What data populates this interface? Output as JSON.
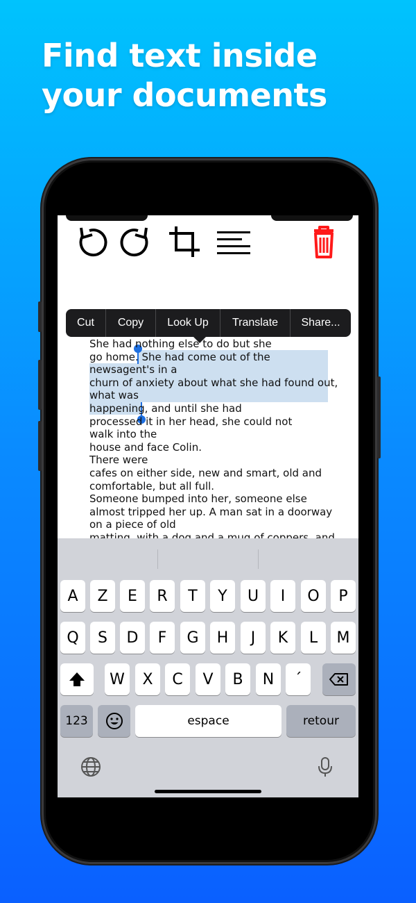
{
  "headline": "Find text inside your documents",
  "toolbar": {
    "icons": [
      "rotate-left-icon",
      "rotate-right-icon",
      "crop-icon",
      "text-align-icon",
      "trash-icon"
    ],
    "trash_color": "#ff1a1a"
  },
  "context_menu": {
    "items": [
      "Cut",
      "Copy",
      "Look Up",
      "Translate",
      "Share..."
    ]
  },
  "document": {
    "lines": [
      "She had nothing else to do but she",
      "go home. She had come out of the",
      "newsagent's in a",
      "churn of anxiety about what she had found out,",
      "what was",
      "happening, and until she had",
      "processed it in her head, she could not",
      "walk into the",
      "house and face Colin.",
      "There were",
      "cafes on either side, new and smart, old and",
      "comfortable, but all full.",
      "Someone bumped into her, someone else",
      "almost tripped her up. A man sat in a doorway",
      "on a piece of old",
      "matting, with a dog and a mug of coppers, and"
    ],
    "selection_color": "#cddff0",
    "handle_color": "#1e6fe0"
  },
  "keyboard": {
    "row1": [
      "A",
      "Z",
      "E",
      "R",
      "T",
      "Y",
      "U",
      "I",
      "O",
      "P"
    ],
    "row2": [
      "Q",
      "S",
      "D",
      "F",
      "G",
      "H",
      "J",
      "K",
      "L",
      "M"
    ],
    "row3": [
      "W",
      "X",
      "C",
      "V",
      "B",
      "N",
      "´"
    ],
    "numbers_key": "123",
    "space_key": "espace",
    "return_key": "retour",
    "icons": [
      "shift-icon",
      "backspace-icon",
      "emoji-icon",
      "globe-icon",
      "microphone-icon"
    ]
  }
}
